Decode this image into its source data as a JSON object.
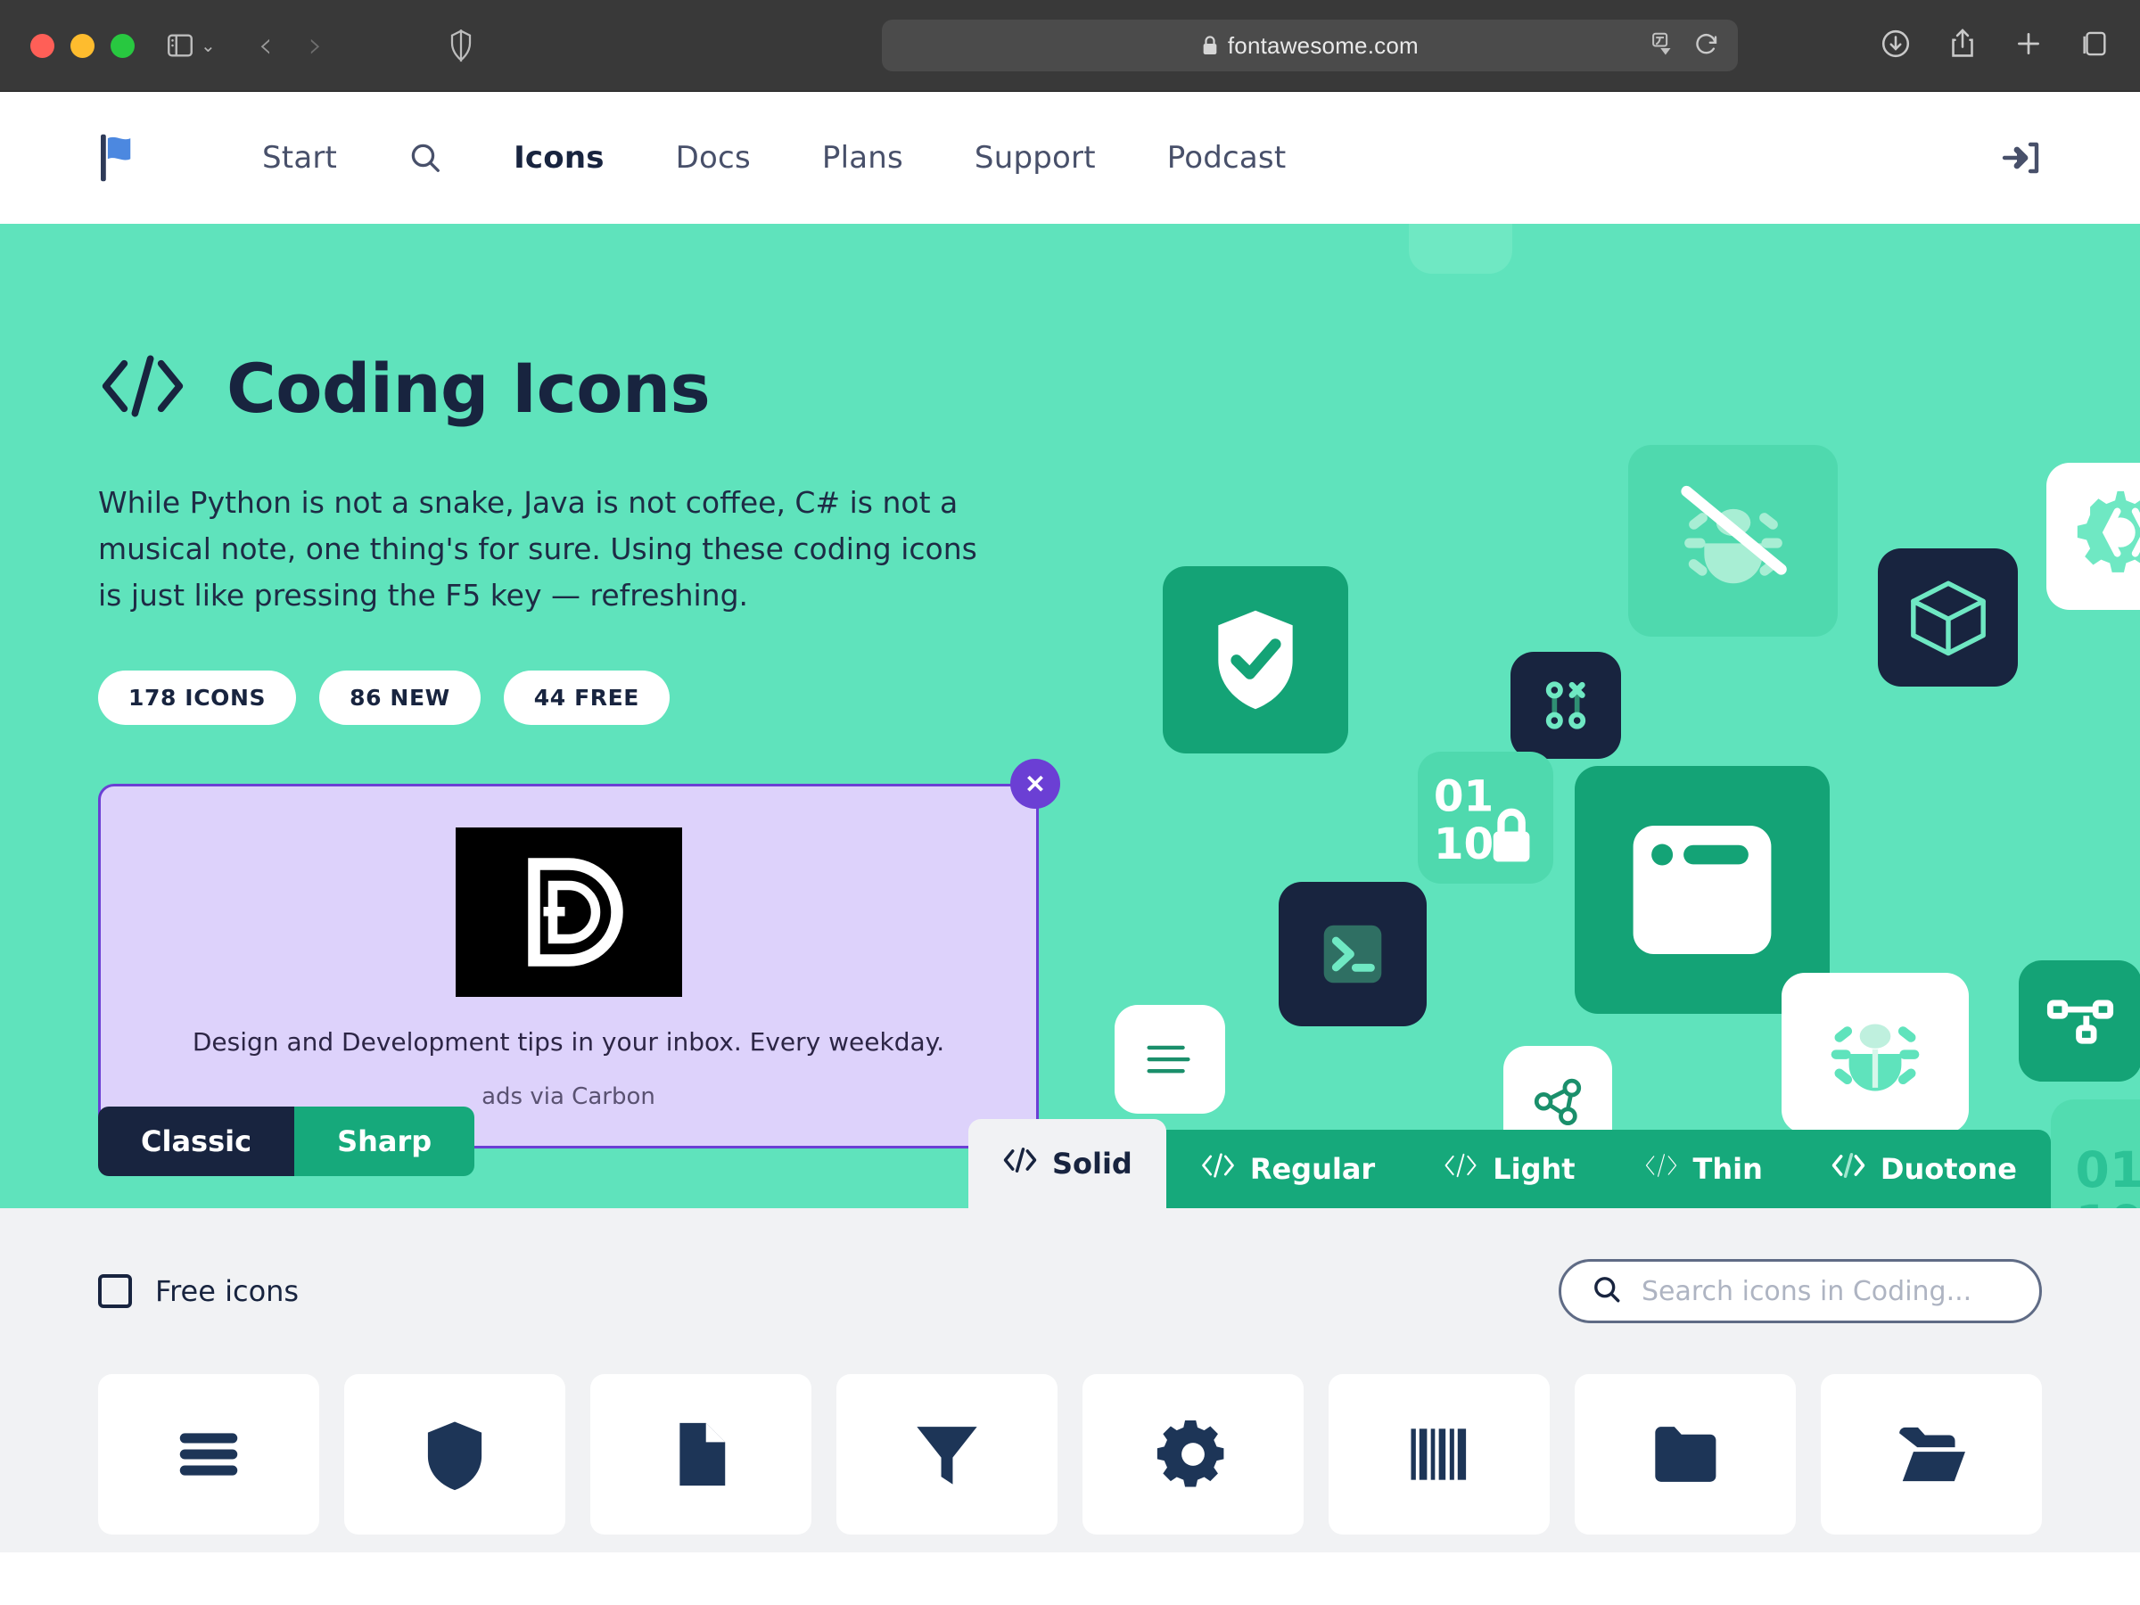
{
  "browser": {
    "url": "fontawesome.com",
    "lock_icon": "lock-icon",
    "sidebar_icon": "sidebar-icon",
    "back_label": "‹",
    "forward_label": "›",
    "shield_icon": "shield-icon",
    "translate_icon": "translate-icon",
    "reload_icon": "reload-icon",
    "downloads_icon": "download-icon",
    "share_icon": "share-icon",
    "newtab_icon": "plus-icon",
    "tabs_icon": "tab-overview-icon"
  },
  "sitenav": {
    "logo": "fontawesome-flag-logo",
    "search_icon": "search-icon",
    "signin_icon": "sign-in-icon",
    "links": [
      {
        "label": "Start",
        "active": false
      },
      {
        "label": "Icons",
        "active": true
      },
      {
        "label": "Docs",
        "active": false
      },
      {
        "label": "Plans",
        "active": false
      },
      {
        "label": "Support",
        "active": false
      },
      {
        "label": "Podcast",
        "active": false
      }
    ]
  },
  "hero": {
    "title": "Coding Icons",
    "title_icon": "code-icon",
    "description": "While Python is not a snake, Java is not coffee, C# is not a musical note, one thing's for sure. Using these coding icons is just like pressing the F5 key — refreshing.",
    "badges": [
      "178 ICONS",
      "86 NEW",
      "44 FREE"
    ],
    "background_color": "#5FE3BC"
  },
  "ad": {
    "text": "Design and Development tips in your inbox. Every weekday.",
    "via": "ads via Carbon",
    "close_label": "✕",
    "logo_alt": "carbon-ad-logo",
    "background_color": "#DDD2FB",
    "border_color": "#6B3FD4"
  },
  "family_toggle": {
    "options": [
      {
        "label": "Classic",
        "active": true
      },
      {
        "label": "Sharp",
        "active": false
      }
    ]
  },
  "style_tabs": [
    {
      "label": "Solid",
      "active": true
    },
    {
      "label": "Regular",
      "active": false
    },
    {
      "label": "Light",
      "active": false
    },
    {
      "label": "Thin",
      "active": false
    },
    {
      "label": "Duotone",
      "active": false
    }
  ],
  "filters": {
    "free_icons_label": "Free icons",
    "free_icons_checked": false,
    "search_placeholder": "Search icons in Coding...",
    "search_value": "",
    "search_icon": "search-icon"
  },
  "icon_grid": [
    {
      "name": "bars-icon"
    },
    {
      "name": "shield-icon"
    },
    {
      "name": "file-icon"
    },
    {
      "name": "filter-icon"
    },
    {
      "name": "gear-icon"
    },
    {
      "name": "barcode-icon"
    },
    {
      "name": "folder-icon"
    },
    {
      "name": "folder-open-icon"
    }
  ],
  "decorations": [
    "shield-check-icon",
    "code-commit-icon",
    "binary-lock-icon",
    "terminal-icon",
    "align-left-icon",
    "share-nodes-icon",
    "window-icon",
    "bug-icon",
    "bug-slash-icon",
    "cube-icon",
    "gear-code-icon",
    "diagram-project-icon",
    "binary-icon"
  ],
  "colors": {
    "mint": "#5FE3BC",
    "green": "#16A97B",
    "navy": "#18243F",
    "light_mint": "#6FE8C3",
    "panel": "#F1F2F4"
  }
}
